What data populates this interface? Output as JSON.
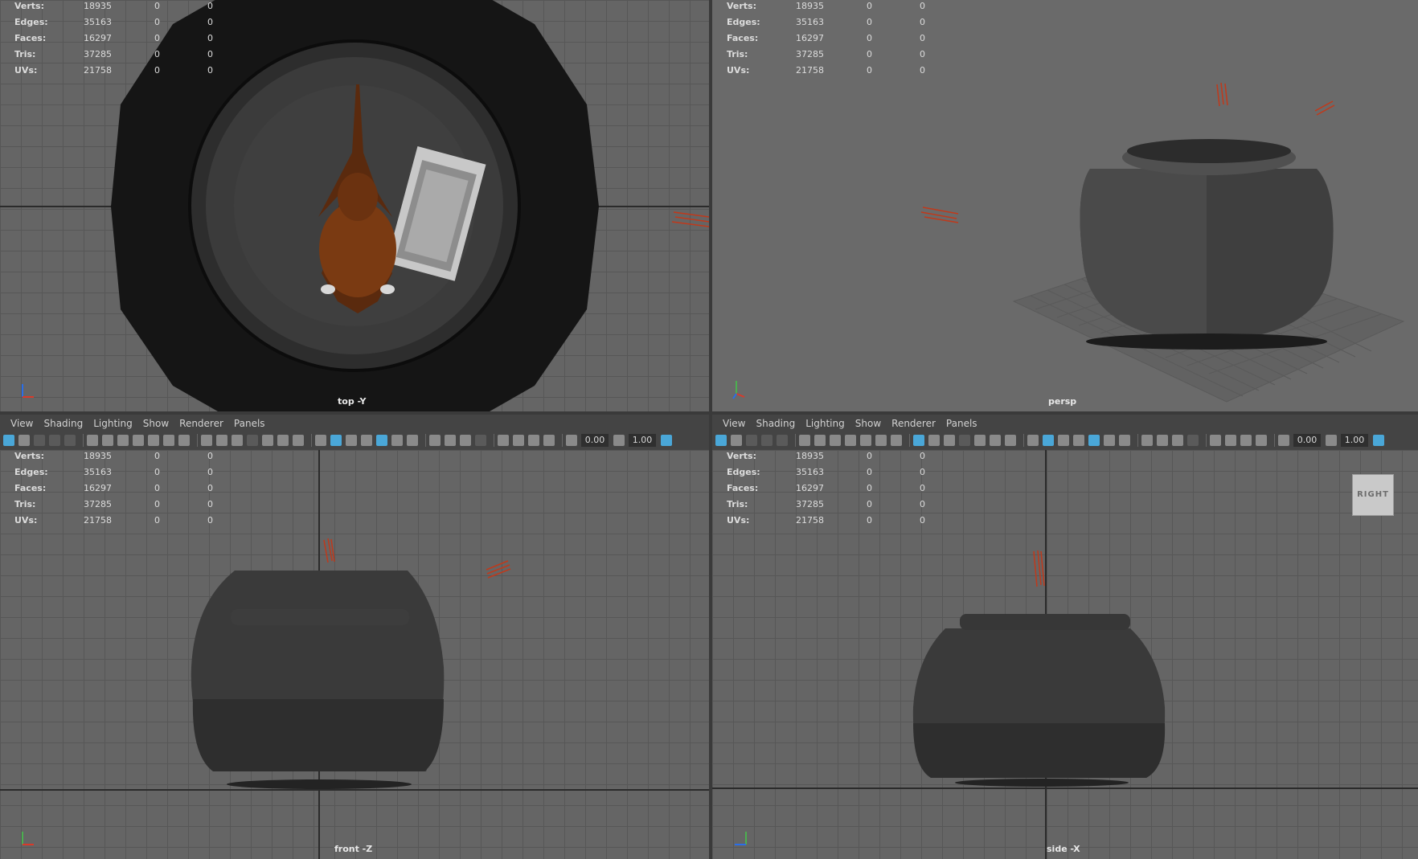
{
  "stats": {
    "labels": [
      "Verts:",
      "Edges:",
      "Faces:",
      "Tris:",
      "UVs:"
    ],
    "values": [
      [
        "18935",
        "0",
        "0"
      ],
      [
        "35163",
        "0",
        "0"
      ],
      [
        "16297",
        "0",
        "0"
      ],
      [
        "37285",
        "0",
        "0"
      ],
      [
        "21758",
        "0",
        "0"
      ]
    ]
  },
  "panels": {
    "top_left": {
      "camera": "top -Y"
    },
    "top_right": {
      "camera": "persp"
    },
    "bottom_left": {
      "camera": "front -Z"
    },
    "bottom_right": {
      "camera": "side -X"
    }
  },
  "menu": [
    "View",
    "Shading",
    "Lighting",
    "Show",
    "Renderer",
    "Panels"
  ],
  "toolbar": {
    "exposure": "0.00",
    "gamma": "1.00"
  },
  "viewcube": {
    "label": "RIGHT"
  },
  "colors": {
    "viewport_bg": "#656565",
    "grid": "#575757",
    "toolbar_accent": "#4aa7d8",
    "light_icon": "#c0391b"
  }
}
